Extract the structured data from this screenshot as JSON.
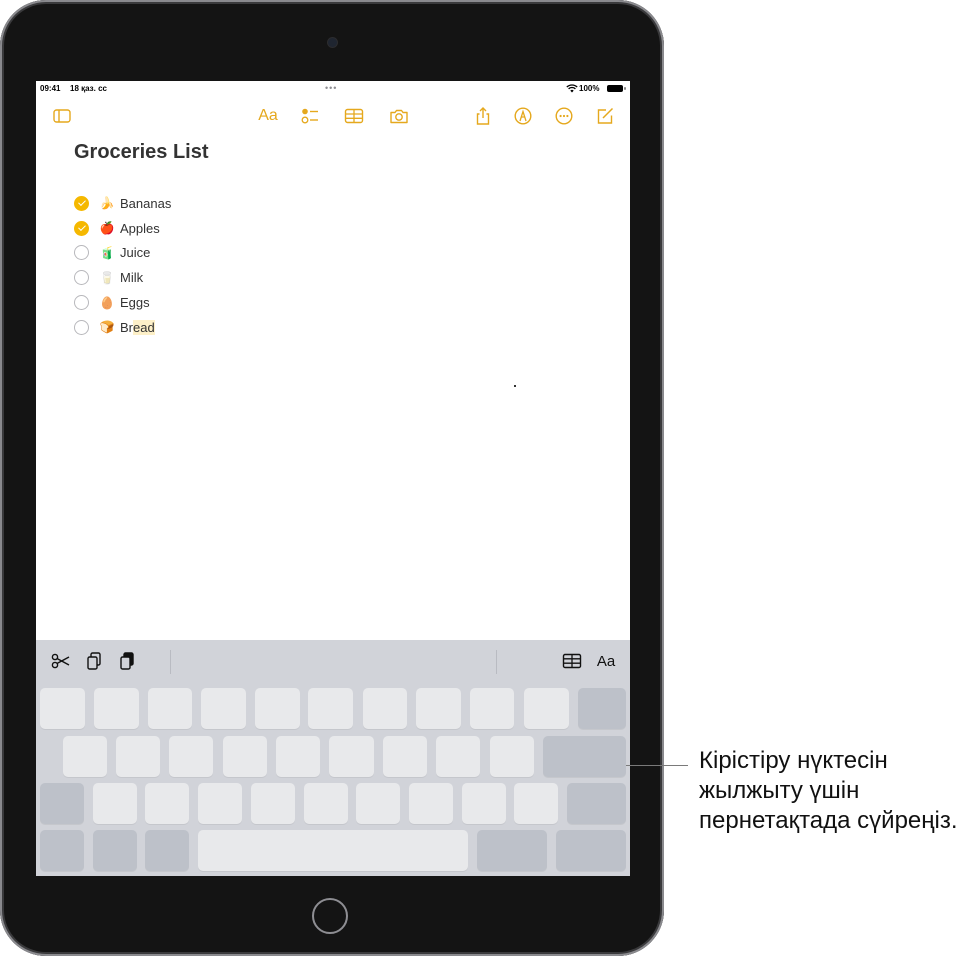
{
  "status_bar": {
    "time": "09:41",
    "date": "18 қаз. сс",
    "dots": "•••",
    "wifi_icon": "wifi-icon",
    "battery_percent": "100%"
  },
  "toolbar": {
    "sidebar_icon": "sidebar-icon",
    "format_label": "Aa",
    "checklist_icon": "checklist-icon",
    "table_icon": "table-icon",
    "camera_icon": "camera-icon",
    "share_icon": "share-icon",
    "markup_icon": "markup-pen-icon",
    "more_icon": "more-icon",
    "compose_icon": "compose-icon",
    "accent_color": "#e5a81d"
  },
  "note": {
    "title": "Groceries List",
    "items": [
      {
        "emoji": "🍌",
        "text": "Bananas",
        "checked": true
      },
      {
        "emoji": "🍎",
        "text": "Apples",
        "checked": true
      },
      {
        "emoji": "🧃",
        "text": "Juice",
        "checked": false
      },
      {
        "emoji": "🥛",
        "text": "Milk",
        "checked": false
      },
      {
        "emoji": "🥚",
        "text": "Eggs",
        "checked": false
      },
      {
        "emoji": "🍞",
        "text_before": "Br",
        "text_selected": "ead",
        "checked": false
      }
    ]
  },
  "keyboard_toolbar": {
    "cut_icon": "scissors-icon",
    "copy_icon": "copy-icon",
    "paste_icon": "paste-icon",
    "table_icon": "table-icon",
    "format_label": "Aa"
  },
  "callout": {
    "text": "Кірістіру нүктесін жылжыту үшін пернетақтада сүйреңіз."
  }
}
